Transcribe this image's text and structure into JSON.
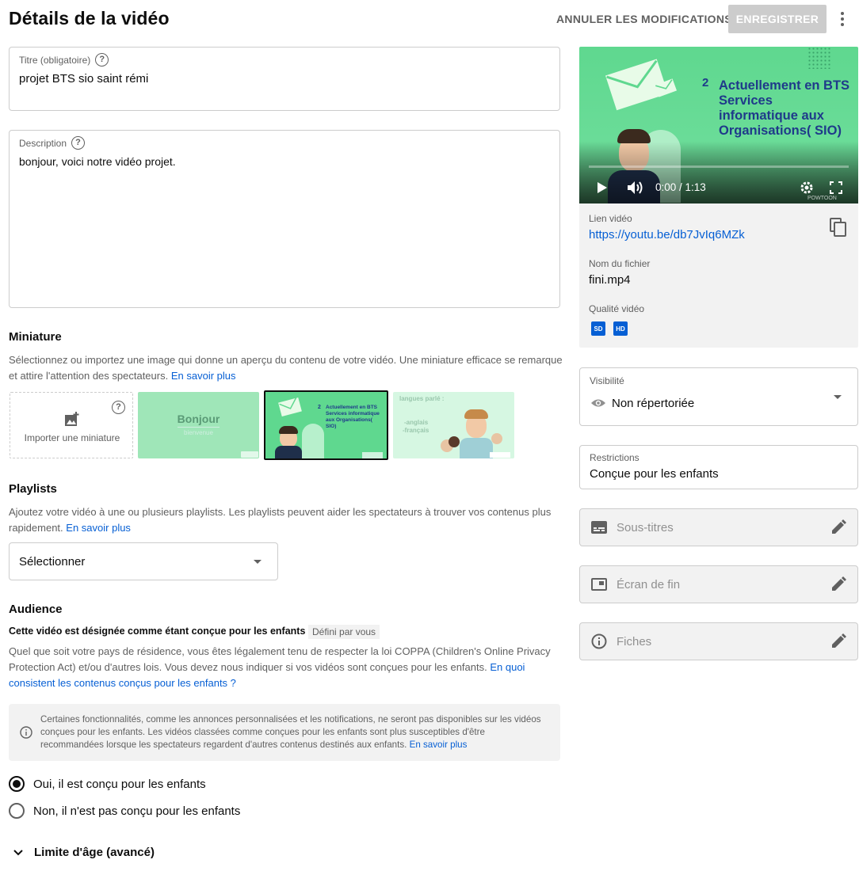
{
  "header": {
    "title": "Détails de la vidéo",
    "undo_label": "ANNULER LES MODIFICATIONS",
    "save_label": "ENREGISTRER"
  },
  "title_field": {
    "label": "Titre (obligatoire)",
    "value": "projet BTS sio saint rémi"
  },
  "description_field": {
    "label": "Description",
    "value": "bonjour, voici notre vidéo projet."
  },
  "thumbnail": {
    "title": "Miniature",
    "text": "Sélectionnez ou importez une image qui donne un aperçu du contenu de votre vidéo. Une miniature efficace se remarque et attire l'attention des spectateurs.",
    "learn_more": "En savoir plus",
    "import_label": "Importer une miniature",
    "options": [
      {
        "title": "Bonjour",
        "subtitle": "bienvenue",
        "selected": false
      },
      {
        "number": "2",
        "title": "Actuellement en BTS Services informatique aux Organisations( SIO)",
        "selected": true
      },
      {
        "title": "langues parlé :",
        "lines": [
          "-anglais",
          "-français"
        ],
        "selected": false
      }
    ]
  },
  "playlists": {
    "title": "Playlists",
    "text": "Ajoutez votre vidéo à une ou plusieurs playlists. Les playlists peuvent aider les spectateurs à trouver vos contenus plus rapidement.",
    "learn_more": "En savoir plus",
    "select_label": "Sélectionner"
  },
  "audience": {
    "title": "Audience",
    "status": "Cette vidéo est désignée comme étant conçue pour les enfants",
    "badge": "Défini par vous",
    "text": "Quel que soit votre pays de résidence, vous êtes légalement tenu de respecter la loi COPPA (Children's Online Privacy Protection Act) et/ou d'autres lois. Vous devez nous indiquer si vos vidéos sont conçues pour les enfants.",
    "text_link": "En quoi consistent les contenus conçus pour les enfants ?",
    "info": "Certaines fonctionnalités, comme les annonces personnalisées et les notifications, ne seront pas disponibles sur les vidéos conçues pour les enfants. Les vidéos classées comme conçues pour les enfants sont plus susceptibles d'être recommandées lorsque les spectateurs regardent d'autres contenus destinés aux enfants.",
    "info_link": "En savoir plus",
    "option_yes": "Oui, il est conçu pour les enfants",
    "option_no": "Non, il n'est pas conçu pour les enfants",
    "age_limit": "Limite d'âge (avancé)"
  },
  "video": {
    "slide_number": "2",
    "slide_title": "Actuellement en BTS Services informatique aux Organisations( SIO)",
    "time": "0:00 / 1:13",
    "watermark": "POWTOON",
    "link_label": "Lien vidéo",
    "link": "https://youtu.be/db7JvIq6MZk",
    "filename_label": "Nom du fichier",
    "filename": "fini.mp4",
    "quality_label": "Qualité vidéo",
    "quality_badges": [
      "SD",
      "HD"
    ]
  },
  "visibility": {
    "label": "Visibilité",
    "value": "Non répertoriée"
  },
  "restrictions": {
    "label": "Restrictions",
    "value": "Conçue pour les enfants"
  },
  "extras": [
    {
      "label": "Sous-titres",
      "icon": "subtitles-icon"
    },
    {
      "label": "Écran de fin",
      "icon": "end-screen-icon"
    },
    {
      "label": "Fiches",
      "icon": "info-icon"
    }
  ],
  "colors": {
    "accent": "#065fd4",
    "slide_green": "#5fd88f",
    "slide_text": "#1f3a8a"
  }
}
